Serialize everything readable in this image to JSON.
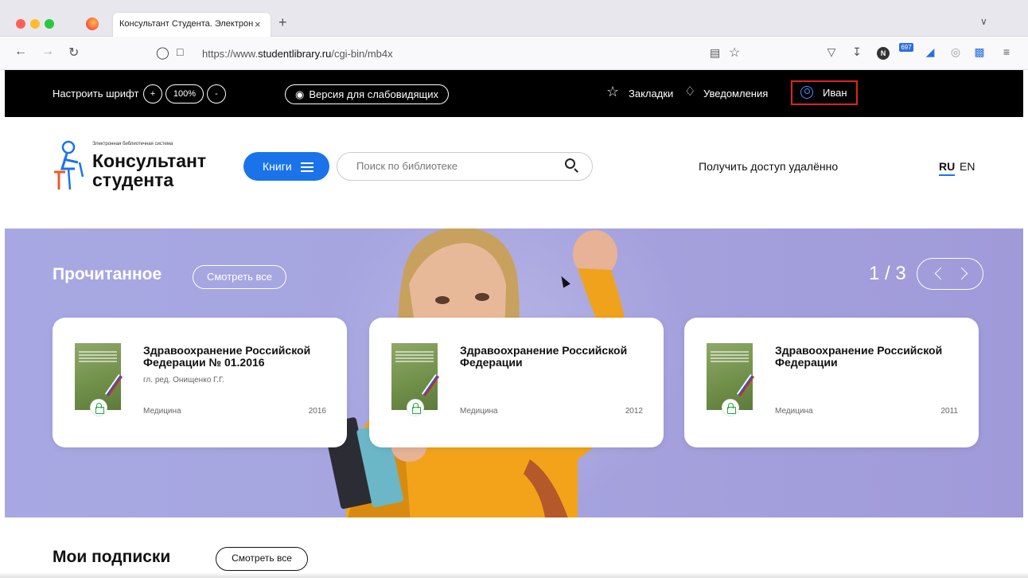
{
  "browser": {
    "tab_title": "Консультант Студента. Электронна",
    "tab_close": "×",
    "new_tab": "+",
    "tab_list": "∨",
    "url_prefix": "https://www.",
    "url_domain": "studentlibrary.ru",
    "url_path": "/cgi-bin/mb4x",
    "nav_back": "←",
    "nav_forward": "→",
    "nav_reload": "↻",
    "extension_badge": "697",
    "extension_n": "N"
  },
  "site_bar": {
    "font_label": "Настроить шрифт",
    "font_plus": "+",
    "font_percent": "100%",
    "font_minus": "-",
    "low_vision_label": "Версия для слабовидящих",
    "bookmarks_label": "Закладки",
    "notifications_label": "Уведомления",
    "user_name": "Иван"
  },
  "header": {
    "logo_subtitle": "Электронная библиотечная система",
    "logo_line1": "Консультант",
    "logo_line2": "студента",
    "books_button": "Книги",
    "search_placeholder": "Поиск по библиотеке",
    "remote_access": "Получить доступ удалённо",
    "lang_ru": "RU",
    "lang_en": "EN"
  },
  "read_section": {
    "title": "Прочитанное",
    "see_all": "Смотреть все",
    "pager": "1 / 3",
    "books": [
      {
        "title": "Здравоохранение Российской Федерации № 01.2016",
        "editor": "гл. ред. Онищенко Г.Г.",
        "category": "Медицина",
        "year": "2016"
      },
      {
        "title": "Здравоохранение Российской Федерации",
        "editor": "",
        "category": "Медицина",
        "year": "2012"
      },
      {
        "title": "Здравоохранение Российской Федерации",
        "editor": "",
        "category": "Медицина",
        "year": "2011"
      }
    ]
  },
  "subscriptions": {
    "title": "Мои подписки",
    "see_all": "Смотреть все"
  },
  "colors": {
    "accent": "#1a73e8",
    "hero_bg": "#a6a4df",
    "highlight": "#e0231b",
    "open_access": "#21a83b"
  }
}
